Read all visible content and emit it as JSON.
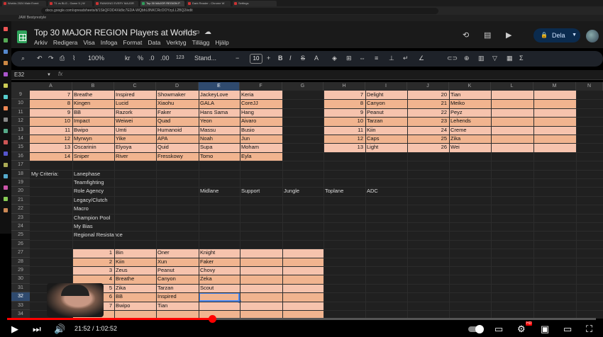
{
  "browser": {
    "tabs": [
      {
        "label": "Worlds 2024 Main Event",
        "active": false
      },
      {
        "label": "T1 vs BLG - Game 5 | W",
        "active": false
      },
      {
        "label": "RANKING EVERY MAJOR",
        "active": false
      },
      {
        "label": "Top 30 MAJOR REGION P",
        "active": true
      },
      {
        "label": "Dark Reader - Chrome W",
        "active": false
      },
      {
        "label": "Settings",
        "active": false
      }
    ],
    "address": "docs.google.com/spreadsheets/d/1SkQFDD4Xk8ic7EDA-WQbhL8NKCRcOOYzyLL2BQ2/edit",
    "bookmark": "JAW Bestyrestyle"
  },
  "sheets": {
    "title": "Top 30 MAJOR REGION Players at Worlds",
    "menu": [
      "Arkiv",
      "Redigera",
      "Visa",
      "Infoga",
      "Format",
      "Data",
      "Verktyg",
      "Tillägg",
      "Hjälp"
    ],
    "share_label": "Dela",
    "toolbar": {
      "zoom": "100%",
      "currency": "kr",
      "percent": "%",
      "decimal_dec": ".0",
      "decimal_inc": ".00",
      "format_123": "123",
      "font": "Stand...",
      "font_size": "10"
    },
    "namebox": "E32",
    "fx": "fx"
  },
  "columns": [
    "A",
    "B",
    "C",
    "D",
    "E",
    "F",
    "G",
    "H",
    "I",
    "J",
    "K",
    "L",
    "M",
    "N"
  ],
  "selected_column": "E",
  "rows": [
    "9",
    "10",
    "11",
    "12",
    "13",
    "14",
    "15",
    "16",
    "17",
    "18",
    "19",
    "20",
    "21",
    "22",
    "23",
    "24",
    "25",
    "26",
    "27",
    "28",
    "29",
    "30",
    "31",
    "32",
    "33",
    "34"
  ],
  "selected_row": "32",
  "table_top": [
    {
      "rank": "7",
      "top": "Breathe",
      "jungle": "Inspired",
      "mid": "Showmaker",
      "adc": "JackeyLove",
      "support": "Keria"
    },
    {
      "rank": "8",
      "top": "Kingen",
      "jungle": "Lucid",
      "mid": "Xiaohu",
      "adc": "GALA",
      "support": "CoreJJ"
    },
    {
      "rank": "9",
      "top": "BB",
      "jungle": "Razork",
      "mid": "Faker",
      "adc": "Hans Sama",
      "support": "Hang"
    },
    {
      "rank": "10",
      "top": "Impact",
      "jungle": "Weiwei",
      "mid": "Quad",
      "adc": "Yeon",
      "support": "Aivaro"
    },
    {
      "rank": "11",
      "top": "Bwipo",
      "jungle": "Umti",
      "mid": "Humanoid",
      "adc": "Massu",
      "support": "Busio"
    },
    {
      "rank": "12",
      "top": "Myrwyn",
      "jungle": "Yike",
      "mid": "APA",
      "adc": "Noah",
      "support": "Jun"
    },
    {
      "rank": "13",
      "top": "Oscarinin",
      "jungle": "Elyoya",
      "mid": "Quid",
      "adc": "Supa",
      "support": "Moham"
    },
    {
      "rank": "14",
      "top": "Sniper",
      "jungle": "River",
      "mid": "Fresskowy",
      "adc": "Tomo",
      "support": "Eyla"
    }
  ],
  "table_right": [
    {
      "rank_a": "7",
      "name_a": "Delight",
      "rank_b": "20",
      "name_b": "Tian"
    },
    {
      "rank_a": "8",
      "name_a": "Canyon",
      "rank_b": "21",
      "name_b": "Meiko"
    },
    {
      "rank_a": "9",
      "name_a": "Peanut",
      "rank_b": "22",
      "name_b": "Peyz"
    },
    {
      "rank_a": "10",
      "name_a": "Tarzan",
      "rank_b": "23",
      "name_b": "Lehends"
    },
    {
      "rank_a": "11",
      "name_a": "Kiin",
      "rank_b": "24",
      "name_b": "Creme"
    },
    {
      "rank_a": "12",
      "name_a": "Caps",
      "rank_b": "25",
      "name_b": "Zika"
    },
    {
      "rank_a": "13",
      "name_a": "Light",
      "rank_b": "26",
      "name_b": "Wei"
    }
  ],
  "criteria_label": "My Criteria:",
  "criteria": [
    "Lanephase",
    "Teamfighting",
    "Role Agency",
    "Legacy/Clutch",
    "Macro",
    "Champion Pool",
    "My Bias",
    "Regional Resistance"
  ],
  "role_headers": [
    "Midlane",
    "Support",
    "Jungle",
    "Toplane",
    "ADC"
  ],
  "table_bottom": [
    {
      "rank": "1",
      "a": "Bin",
      "b": "Oner",
      "c": "Knight"
    },
    {
      "rank": "2",
      "a": "Kiin",
      "b": "Xun",
      "c": "Faker"
    },
    {
      "rank": "3",
      "a": "Zeus",
      "b": "Peanut",
      "c": "Chovy"
    },
    {
      "rank": "4",
      "a": "Breathe",
      "b": "Canyon",
      "c": "Zeka"
    },
    {
      "rank": "5",
      "a": "Zika",
      "b": "Tarzan",
      "c": "Scout"
    },
    {
      "rank": "6",
      "a": "BB",
      "b": "Inspired",
      "c": ""
    },
    {
      "rank": "7",
      "a": "Bwipo",
      "b": "Tian",
      "c": ""
    }
  ],
  "video": {
    "timecode": "21:52 / 1:02:52",
    "progress": 0.348,
    "hd_badge": "HD"
  },
  "colors": {
    "band_a": "#f6c3ad",
    "band_b": "#f1b48f",
    "accent_blue": "#4a8af4",
    "progress_red": "#ff0000"
  }
}
